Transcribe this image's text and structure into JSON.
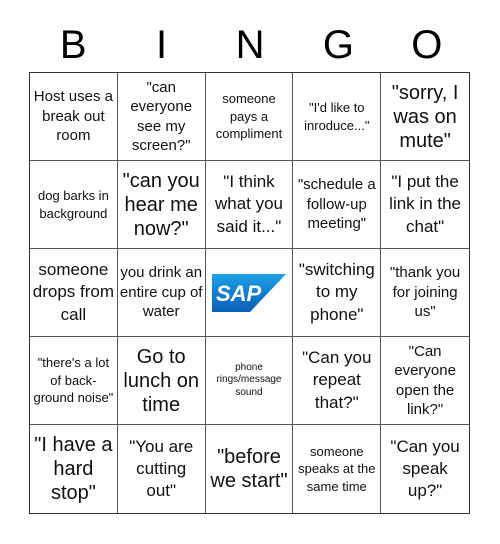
{
  "header": {
    "letters": [
      "B",
      "I",
      "N",
      "G",
      "O"
    ]
  },
  "board": {
    "cells": [
      "Host uses a break out room",
      "\"can everyone see my screen?\"",
      "someone pays a compliment",
      "\"I'd like to inroduce...\"",
      "\"sorry, I was on mute\"",
      "dog barks in background",
      "\"can you hear me now?\"",
      "\"I think what you said it...\"",
      "\"schedule a follow-up meeting\"",
      "\"I put the link in the chat\"",
      "someone drops from call",
      "you drink an entire cup of water",
      "",
      "\"switching to my phone\"",
      "\"thank you for joining us\"",
      "\"there's a lot of back-ground noise\"",
      "Go to lunch on time",
      "phone rings/message sound",
      "\"Can you repeat that?\"",
      "\"Can everyone open the link?\"",
      "\"I have a hard stop\"",
      "\"You are cutting out\"",
      "\"before we start\"",
      "someone speaks at the same time",
      "\"Can you speak up?\""
    ],
    "free_space": {
      "logo": "SAP",
      "logo_icon": "sap-logo-icon",
      "colors": {
        "top": "#1ea0e6",
        "bottom": "#0a5fb4",
        "text": "#ffffff"
      }
    }
  }
}
